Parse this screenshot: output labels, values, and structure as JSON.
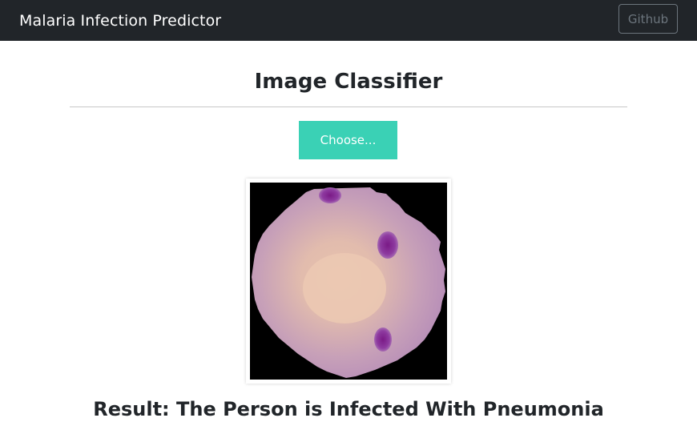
{
  "navbar": {
    "brand": "Malaria Infection Predictor",
    "github_label": "Github"
  },
  "main": {
    "title": "Image Classifier",
    "choose_label": "Choose...",
    "result_text": "Result: The Person is Infected With Pneumonia"
  },
  "colors": {
    "navbar_bg": "#212529",
    "accent": "#3ad1b5",
    "text": "#212529",
    "muted": "#6c757d"
  },
  "icons": {
    "preview": "blood-cell-image"
  }
}
